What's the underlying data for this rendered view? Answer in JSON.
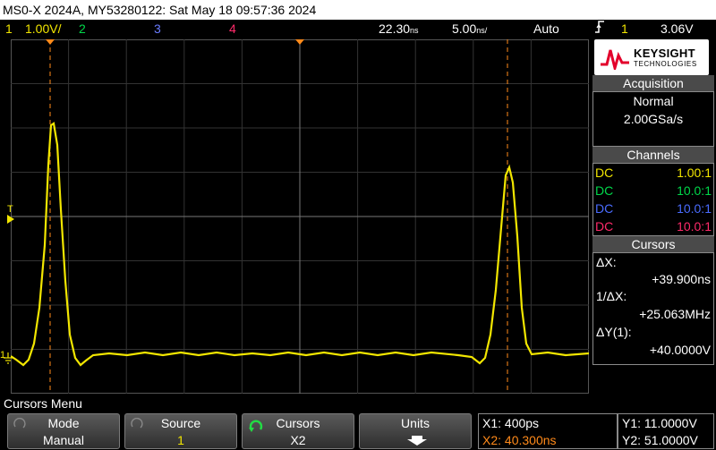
{
  "title": "MS0-X 2024A, MY53280122: Sat May 18 09:57:36 2024",
  "status": {
    "ch1_num": "1",
    "ch1_scale": "1.00V/",
    "ch2": "2",
    "ch3": "3",
    "ch4": "4",
    "delay": "22.30",
    "delay_unit": "ns",
    "timebase": "5.00",
    "timebase_unit": "ns/",
    "trigger_mode": "Auto",
    "trigger_slope_icon": "rising-edge-icon",
    "trigger_source": "1",
    "trigger_level": "3.06V"
  },
  "brand": {
    "name": "KEYSIGHT",
    "sub": "TECHNOLOGIES"
  },
  "acquisition": {
    "heading": "Acquisition",
    "mode": "Normal",
    "rate": "2.00GSa/s"
  },
  "channels": {
    "heading": "Channels",
    "rows": [
      {
        "coupling": "DC",
        "probe": "1.00:1",
        "color": "#f2e600"
      },
      {
        "coupling": "DC",
        "probe": "10.0:1",
        "color": "#00d84a"
      },
      {
        "coupling": "DC",
        "probe": "10.0:1",
        "color": "#4a6cff"
      },
      {
        "coupling": "DC",
        "probe": "10.0:1",
        "color": "#ff2a6a"
      }
    ]
  },
  "cursors": {
    "heading": "Cursors",
    "dx_label": "ΔX:",
    "dx_value": "+39.900ns",
    "inv_dx_label": "1/ΔX:",
    "inv_dx_value": "+25.063MHz",
    "dy_label": "ΔY(1):",
    "dy_value": "+40.0000V"
  },
  "menu": {
    "title": "Cursors Menu",
    "mode_label": "Mode",
    "mode_value": "Manual",
    "source_label": "Source",
    "source_value": "1",
    "cursors_label": "Cursors",
    "cursors_value": "X2",
    "units_label": "Units"
  },
  "readout": {
    "x1": "X1: 400ps",
    "x2": "X2: 40.300ns",
    "y1": "Y1: 11.0000V",
    "y2": "Y2: 51.0000V"
  },
  "markers": {
    "ground_label": "1",
    "trigger_label": "T"
  },
  "colors": {
    "ch1": "#f2e600",
    "ch2": "#00d84a",
    "ch3": "#4a6cff",
    "ch4": "#ff2a6a",
    "cursor": "#ff8a1a",
    "x2_readout": "#ff8a1a"
  }
}
